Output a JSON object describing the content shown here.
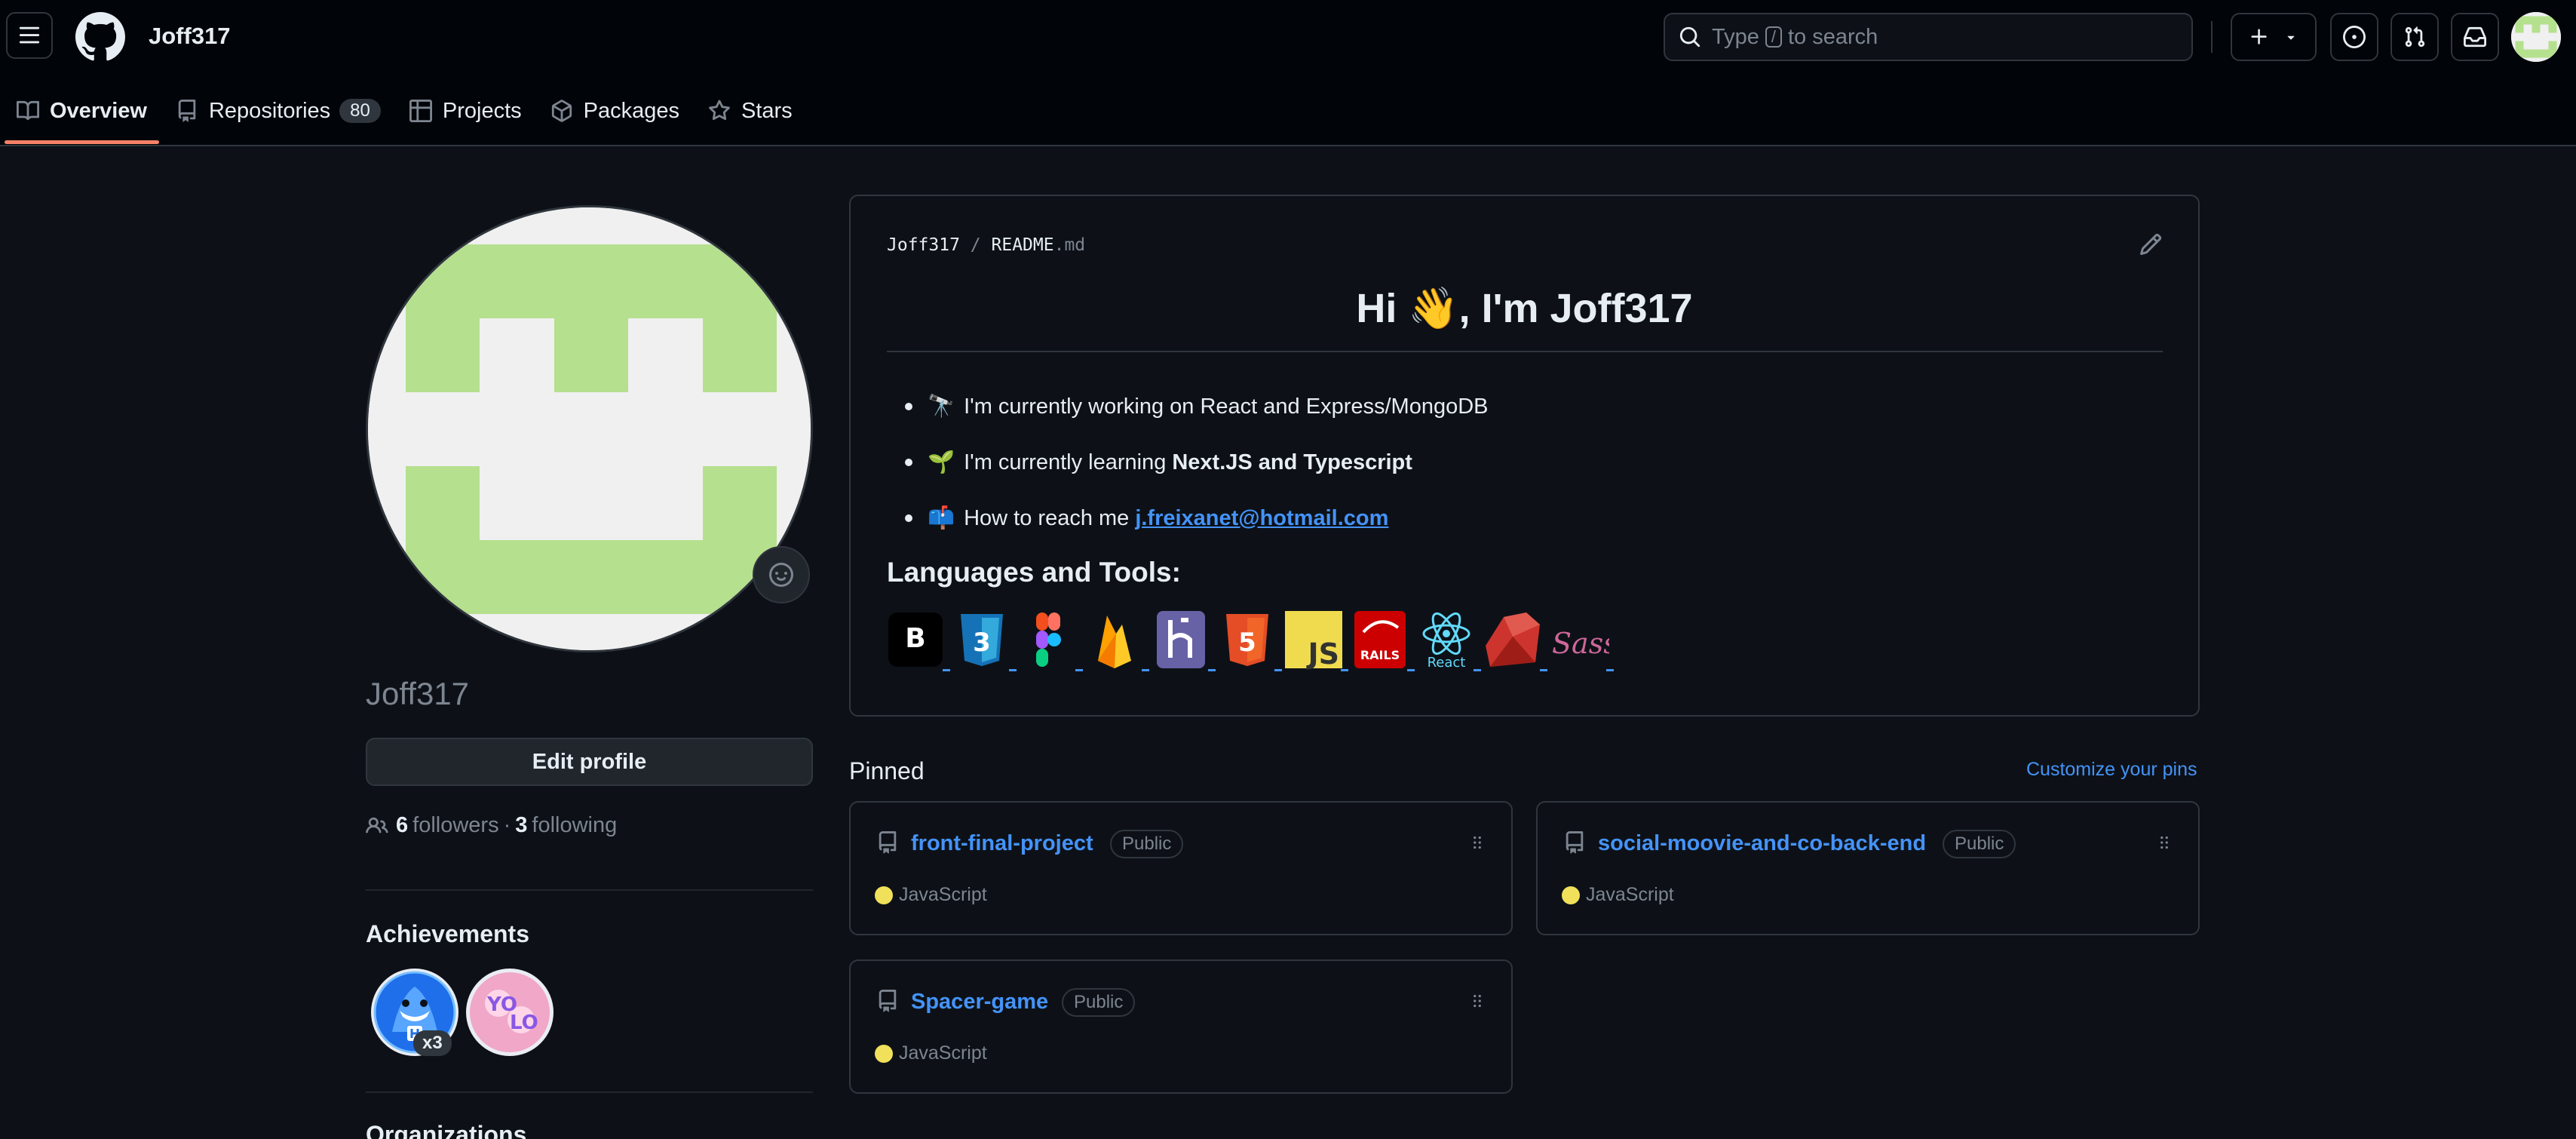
{
  "header": {
    "username": "Joff317",
    "search": {
      "prefix": "Type",
      "key": "/",
      "suffix": "to search"
    }
  },
  "tabs": [
    {
      "label": "Overview",
      "icon": "book-icon",
      "selected": true
    },
    {
      "label": "Repositories",
      "icon": "repo-icon",
      "count": "80"
    },
    {
      "label": "Projects",
      "icon": "table-icon"
    },
    {
      "label": "Packages",
      "icon": "package-icon"
    },
    {
      "label": "Stars",
      "icon": "star-icon"
    }
  ],
  "profile": {
    "name": "Joff317",
    "edit_label": "Edit profile",
    "followers_count": "6",
    "followers_label": "followers",
    "separator": "·",
    "following_count": "3",
    "following_label": "following",
    "achievements_title": "Achievements",
    "achievement_multiplier": "x3",
    "organizations_title": "Organizations"
  },
  "readme": {
    "owner": "Joff317",
    "slash": "/",
    "file": "README",
    "ext": ".md",
    "heading": "Hi 👋, I'm Joff317",
    "items": [
      {
        "emoji": "🔭",
        "text": "I'm currently working on React and Express/MongoDB"
      },
      {
        "emoji": "🌱",
        "text": "I'm currently learning",
        "bold": "Next.JS and Typescript"
      },
      {
        "emoji": "📫",
        "text": "How to reach me",
        "link": "j.freixanet@hotmail.com"
      }
    ],
    "tools_title": "Languages and Tools:",
    "tools": [
      "bootstrap",
      "css3",
      "figma",
      "firebase",
      "heroku",
      "html5",
      "javascript",
      "rails",
      "react",
      "ruby",
      "sass"
    ],
    "react_label": "React",
    "rails_label": "RAILS",
    "js_label": "JS"
  },
  "pinned": {
    "title": "Pinned",
    "customize": "Customize your pins",
    "repos": [
      {
        "name": "front-final-project",
        "visibility": "Public",
        "language": "JavaScript"
      },
      {
        "name": "social-moovie-and-co-back-end",
        "visibility": "Public",
        "language": "JavaScript"
      },
      {
        "name": "Spacer-game",
        "visibility": "Public",
        "language": "JavaScript"
      }
    ]
  },
  "colors": {
    "accent": "#4493f8",
    "tab_underline": "#f78166",
    "javascript": "#f1e05a",
    "identicon": "#b5e08e"
  }
}
